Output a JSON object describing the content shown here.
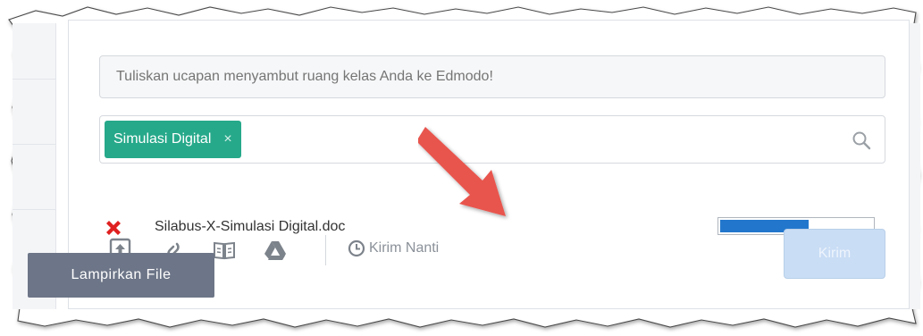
{
  "composer": {
    "greeting_placeholder": "Tuliskan ucapan menyambut ruang kelas Anda ke Edmodo!",
    "recipient": {
      "chip_label": "Simulasi Digital",
      "chip_remove": "×"
    },
    "attachment": {
      "file_name": "Silabus-X-Simulasi Digital.doc",
      "upload_progress": 0.58
    },
    "toolbar": {
      "icons": [
        "upload-file-icon",
        "link-icon",
        "library-icon",
        "google-drive-icon"
      ],
      "schedule_label": "Kirim Nanti",
      "send_label": "Kirim"
    },
    "tooltip": "Lampirkan File"
  },
  "colors": {
    "chip": "#26a98a",
    "progress": "#2277cc",
    "send_disabled": "#c9ddf5",
    "remove_x": "#e02020",
    "annotation_arrow": "#e8554e",
    "tooltip": "#6d7688"
  }
}
